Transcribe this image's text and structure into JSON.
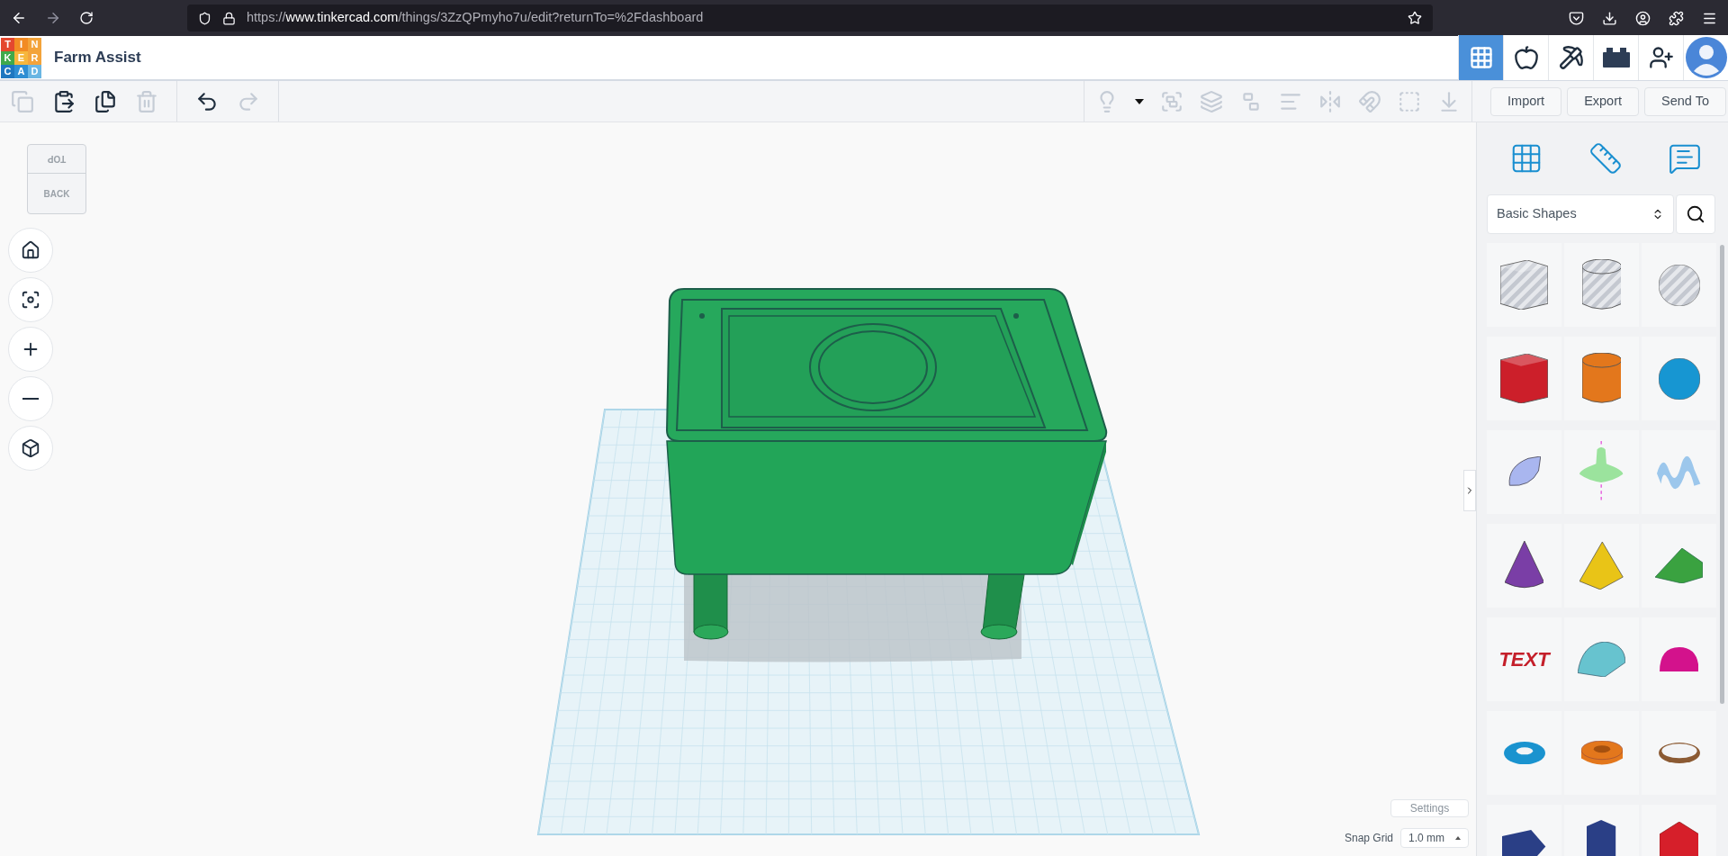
{
  "browser": {
    "url": {
      "prefix": "https://",
      "host": "www.tinkercad.com",
      "path": "/things/3ZzQPmyho7u/edit?returnTo=%2Fdashboard"
    }
  },
  "logo": [
    {
      "letter": "T",
      "color": "#e4472f"
    },
    {
      "letter": "I",
      "color": "#f28b24"
    },
    {
      "letter": "N",
      "color": "#f3a33a"
    },
    {
      "letter": "K",
      "color": "#3fa94b"
    },
    {
      "letter": "E",
      "color": "#f6b73c"
    },
    {
      "letter": "R",
      "color": "#f3a33a"
    },
    {
      "letter": "C",
      "color": "#1e77c0"
    },
    {
      "letter": "A",
      "color": "#2f8ed3"
    },
    {
      "letter": "D",
      "color": "#6ab6e3"
    }
  ],
  "title": "Farm Assist",
  "header_tabs": [
    {
      "kind": "grid",
      "selected": true
    },
    {
      "kind": "apple",
      "selected": false
    },
    {
      "kind": "pickaxe",
      "selected": false
    },
    {
      "kind": "brick",
      "selected": false
    },
    {
      "kind": "add-user",
      "selected": false
    },
    {
      "kind": "avatar",
      "selected": false
    }
  ],
  "toolbar_left": [
    {
      "kind": "copy",
      "disabled": true
    },
    {
      "kind": "paste",
      "disabled": false
    },
    {
      "kind": "duplicate",
      "disabled": false
    },
    {
      "kind": "delete",
      "disabled": true
    },
    {
      "kind": "undo",
      "disabled": false
    },
    {
      "kind": "redo",
      "disabled": true
    }
  ],
  "toolbar_right": [
    {
      "kind": "bulb",
      "disabled": true
    },
    {
      "kind": "caret",
      "disabled": false
    },
    {
      "kind": "group",
      "disabled": true
    },
    {
      "kind": "merge",
      "disabled": true
    },
    {
      "kind": "ungroup",
      "disabled": true
    },
    {
      "kind": "align",
      "disabled": true
    },
    {
      "kind": "mirror",
      "disabled": true
    },
    {
      "kind": "magnet",
      "disabled": true
    },
    {
      "kind": "workplane",
      "disabled": true
    },
    {
      "kind": "drop",
      "disabled": true
    }
  ],
  "actions": [
    "Import",
    "Export",
    "Send To"
  ],
  "view_cube": {
    "top": "TOP",
    "front": "BACK"
  },
  "nav": [
    {
      "kind": "home"
    },
    {
      "kind": "fit"
    },
    {
      "kind": "zoom-in"
    },
    {
      "kind": "zoom-out"
    },
    {
      "kind": "perspective"
    }
  ],
  "panel": {
    "tools": [
      {
        "kind": "grid"
      },
      {
        "kind": "ruler"
      },
      {
        "kind": "note"
      }
    ],
    "category": "Basic Shapes",
    "shapes": [
      {
        "kind": "box",
        "hole": true
      },
      {
        "kind": "cylinder",
        "hole": true
      },
      {
        "kind": "sphere",
        "hole": true
      },
      {
        "kind": "box",
        "hole": false,
        "color": "#cc1f2a"
      },
      {
        "kind": "cylinder",
        "hole": false,
        "color": "#e3771c"
      },
      {
        "kind": "sphere",
        "hole": false,
        "color": "#1796d2"
      },
      {
        "kind": "pen",
        "hole": false,
        "color": "#a9b6ef"
      },
      {
        "kind": "spinner",
        "hole": false,
        "color": "#9be39d"
      },
      {
        "kind": "wave",
        "hole": false,
        "color": "#9cc7ec"
      },
      {
        "kind": "cone",
        "hole": false,
        "color": "#7a3ea6"
      },
      {
        "kind": "pyramid",
        "hole": false,
        "color": "#e9c417"
      },
      {
        "kind": "wedge",
        "hole": false,
        "color": "#3aa240"
      },
      {
        "kind": "text",
        "hole": false,
        "color": "#c41f2a",
        "label": "TEXT"
      },
      {
        "kind": "roof",
        "hole": false,
        "color": "#67c3cf"
      },
      {
        "kind": "hemisphere",
        "hole": false,
        "color": "#d3128c"
      },
      {
        "kind": "torus",
        "hole": false,
        "color": "#1a93cf"
      },
      {
        "kind": "tube",
        "hole": false,
        "color": "#e3771c"
      },
      {
        "kind": "ring",
        "hole": false,
        "color": "#8b5a33"
      },
      {
        "kind": "prism",
        "hole": false,
        "color": "#2a3f86"
      },
      {
        "kind": "hexprism",
        "hole": false,
        "color": "#2a3f86"
      },
      {
        "kind": "gem",
        "hole": false,
        "color": "#d61f2a"
      }
    ]
  },
  "settings": "Settings",
  "snap_grid": {
    "label": "Snap Grid",
    "value": "1.0 mm"
  }
}
